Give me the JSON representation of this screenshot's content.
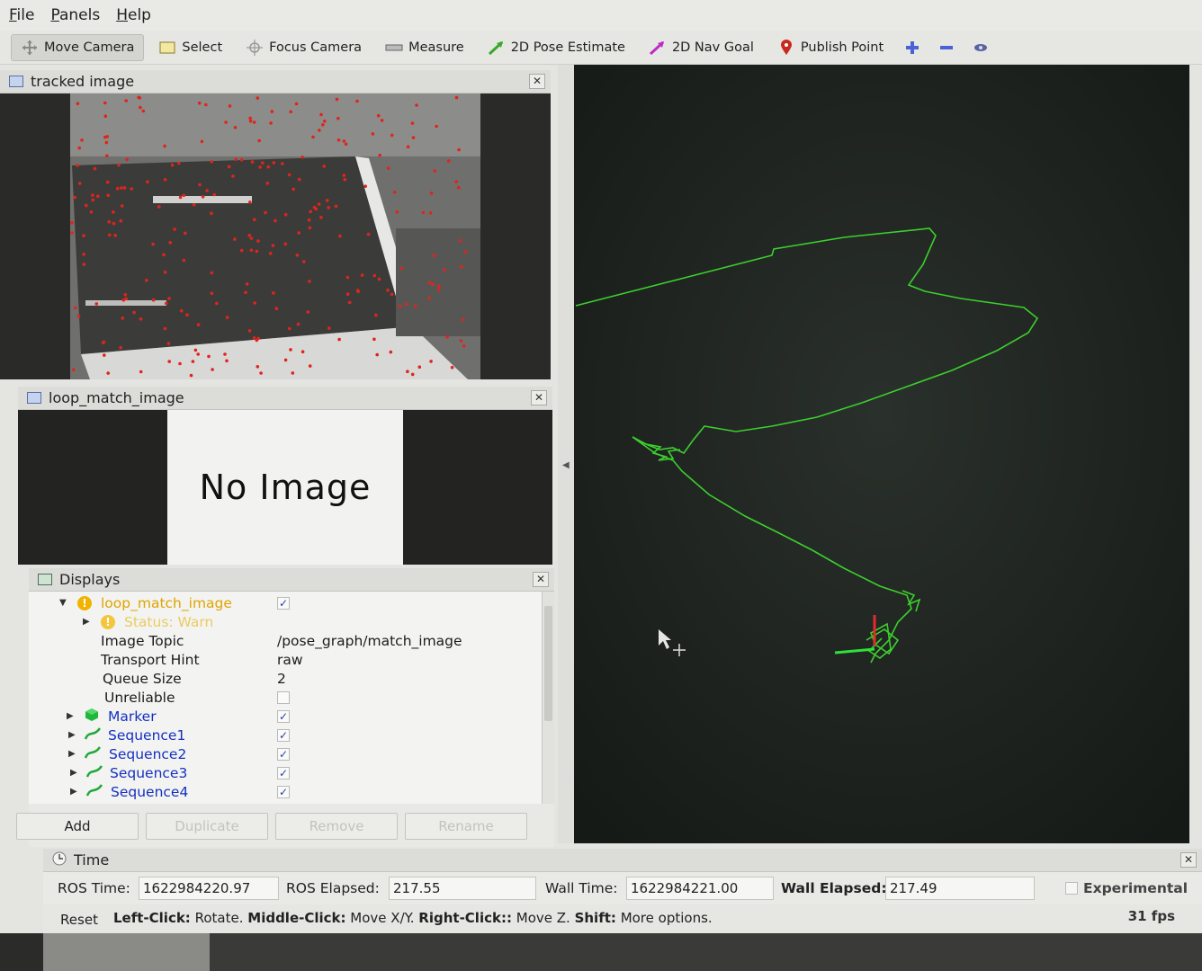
{
  "menubar": {
    "file": "File",
    "panels": "Panels",
    "help": "Help"
  },
  "toolbar": {
    "move_camera": "Move Camera",
    "select": "Select",
    "focus_camera": "Focus Camera",
    "measure": "Measure",
    "pose_estimate": "2D Pose Estimate",
    "nav_goal": "2D Nav Goal",
    "publish_point": "Publish Point"
  },
  "tracked_panel": {
    "title": "tracked image"
  },
  "loop_panel": {
    "title": "loop_match_image",
    "placeholder": "No Image"
  },
  "displays": {
    "title": "Displays",
    "rows": {
      "loop_match_image": "loop_match_image",
      "status": "Status: Warn",
      "image_topic_label": "Image Topic",
      "image_topic_value": "/pose_graph/match_image",
      "transport_hint_label": "Transport Hint",
      "transport_hint_value": "raw",
      "queue_size_label": "Queue Size",
      "queue_size_value": "2",
      "unreliable_label": "Unreliable",
      "marker": "Marker",
      "sequence1": "Sequence1",
      "sequence2": "Sequence2",
      "sequence3": "Sequence3",
      "sequence4": "Sequence4"
    },
    "check_mark": "✓",
    "buttons": {
      "add": "Add",
      "duplicate": "Duplicate",
      "remove": "Remove",
      "rename": "Rename"
    }
  },
  "time": {
    "title": "Time",
    "ros_time_label": "ROS Time:",
    "ros_time": "1622984220.97",
    "ros_elapsed_label": "ROS Elapsed:",
    "ros_elapsed": "217.55",
    "wall_time_label": "Wall Time:",
    "wall_time": "1622984221.00",
    "wall_elapsed_label": "Wall Elapsed:",
    "wall_elapsed": "217.49",
    "experimental": "Experimental"
  },
  "status_bar": {
    "reset": "Reset",
    "h1_key": "Left-Click:",
    "h1_val": "Rotate.",
    "h2_key": "Middle-Click:",
    "h2_val": "Move X/Y.",
    "h3_key": "Right-Click::",
    "h3_val": "Move Z.",
    "h4_key": "Shift:",
    "h4_val": "More options.",
    "fps": "31 fps"
  },
  "colors": {
    "trajectory": "#3ccf2e",
    "warn": "#e0a400",
    "link_blue": "#1530c2"
  }
}
